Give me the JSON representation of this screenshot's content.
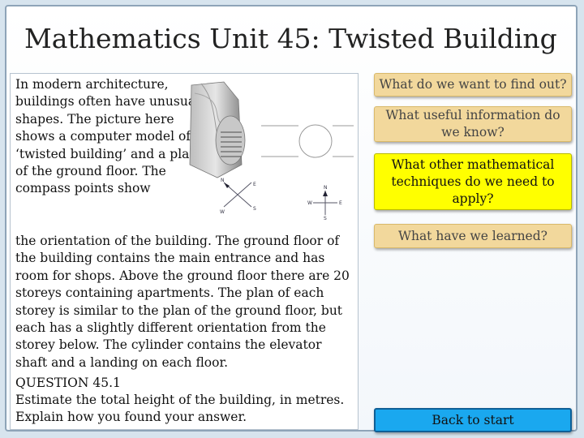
{
  "slide": {
    "title": "Mathematics Unit 45: Twisted Building"
  },
  "content": {
    "intro": "In modern architecture, buildings often have unusual shapes.  The picture here shows a computer model of a ‘twisted building’ and a plan of the ground floor. The compass points show",
    "body": "the orientation of the building. The ground floor of the building contains the main entrance and has room for shops.  Above the ground floor there are 20 storeys containing apartments. The plan of each storey is similar to the plan of the ground floor, but each has a slightly different orientation from the storey below.  The cylinder contains the elevator shaft and a landing on each floor.",
    "question_title": "QUESTION 45.1",
    "question_word1": "Estimate",
    "question_rest": " the total height of the building, in metres. Explain how you found your answer."
  },
  "figure": {
    "compass_left": {
      "n": "N",
      "e": "E",
      "s": "S",
      "w": "W"
    },
    "compass_right": {
      "n": "N",
      "e": "E",
      "s": "S",
      "w": "W"
    }
  },
  "buttons": {
    "find_out": "What do we want to find out?",
    "useful_info": "What useful information do we know?",
    "techniques": "What other mathematical techniques do we need to apply?",
    "learned": "What have we learned?",
    "back": "Back to start"
  },
  "colors": {
    "beige_button": "#f2d89c",
    "yellow_button": "#ffff00",
    "blue_button": "#1aa8ef"
  }
}
